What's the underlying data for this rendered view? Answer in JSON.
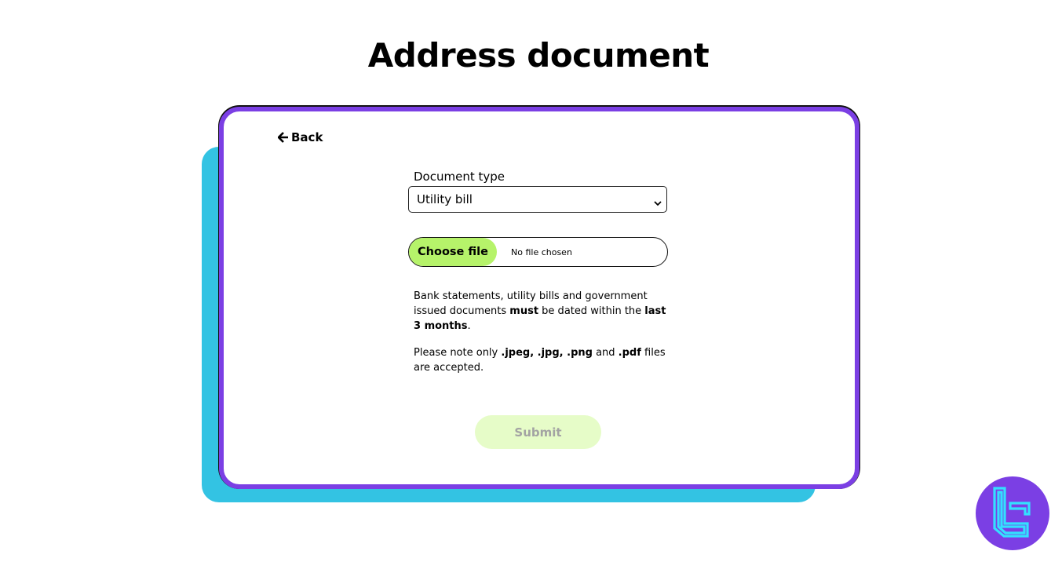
{
  "page": {
    "title": "Address document"
  },
  "nav": {
    "back_label": "Back",
    "back_icon": "arrow-left-icon"
  },
  "form": {
    "document_type_label": "Document type",
    "document_type_selected": "Utility bill",
    "file_button_label": "Choose file",
    "file_status": "No file chosen",
    "submit_label": "Submit"
  },
  "notes": {
    "line1": {
      "t1": "Bank statements, utility bills and government issued documents ",
      "b1": "must",
      "t2": " be dated within the ",
      "b2": "last 3 months",
      "t3": "."
    },
    "line2": {
      "t1": "Please note only ",
      "b1": ".jpeg, .jpg, .png",
      "t2": " and ",
      "b2": ".pdf",
      "t3": " files are accepted."
    }
  },
  "colors": {
    "card_border": "#7b3fe4",
    "card_shadow": "#33c3e3",
    "choose_button": "#b6f36a",
    "submit_disabled": "#e6fcc8",
    "logo_bg": "#7b3fe4",
    "logo_mark": "#33e0ff"
  },
  "logo": {
    "icon": "brand-logo-icon"
  }
}
